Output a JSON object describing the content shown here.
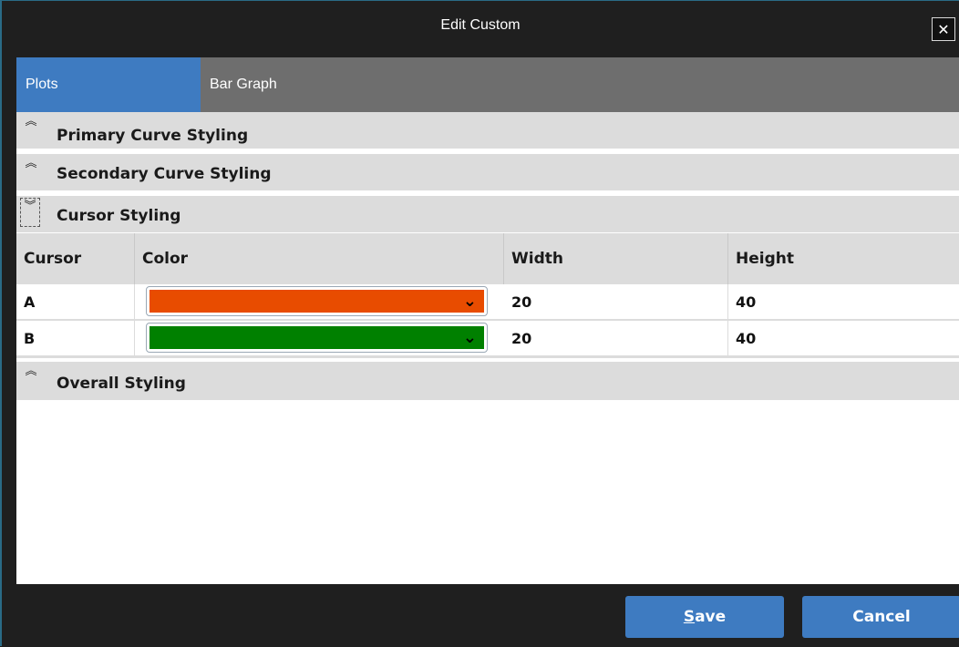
{
  "window": {
    "title": "Edit Custom",
    "close_glyph": "✕"
  },
  "tabs": [
    {
      "label": "Plots",
      "active": true
    },
    {
      "label": "Bar Graph",
      "active": false
    }
  ],
  "sections": {
    "primary": {
      "label": "Primary Curve Styling",
      "icon": "double-chevron-up-icon",
      "expanded": false
    },
    "secondary": {
      "label": "Secondary Curve Styling",
      "icon": "double-chevron-up-icon",
      "expanded": false
    },
    "cursor": {
      "label": "Cursor Styling",
      "icon": "double-chevron-down-icon",
      "expanded": true
    },
    "overall": {
      "label": "Overall Styling",
      "icon": "double-chevron-up-icon",
      "expanded": false
    }
  },
  "grid": {
    "columns": [
      "Cursor",
      "Color",
      "Width",
      "Height"
    ],
    "rows": [
      {
        "cursor": "A",
        "color": "#e84c00",
        "width": "20",
        "height": "40"
      },
      {
        "cursor": "B",
        "color": "#008000",
        "width": "20",
        "height": "40"
      }
    ]
  },
  "buttons": {
    "save_mnemonic": "S",
    "save_rest": "ave",
    "cancel_label": "Cancel"
  },
  "icons": {
    "collapsed": "︽",
    "expanded": "︾",
    "dropdown": "⌄"
  },
  "colors": {
    "accent": "#3e7bc1",
    "tab_bar": "#6e6e6e",
    "section_bg": "#dcdcdc",
    "chrome": "#1f1f1f"
  }
}
